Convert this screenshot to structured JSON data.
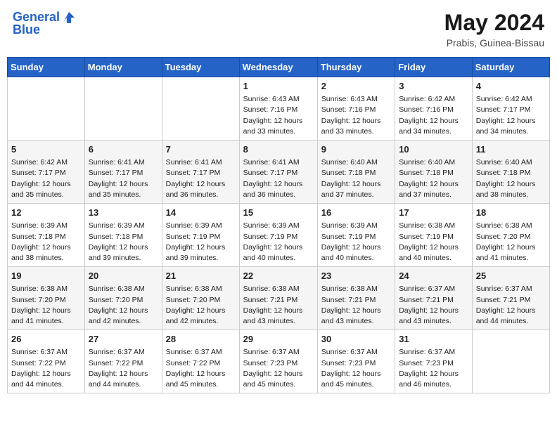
{
  "header": {
    "logo_line1": "General",
    "logo_line2": "Blue",
    "month_year": "May 2024",
    "location": "Prabis, Guinea-Bissau"
  },
  "weekdays": [
    "Sunday",
    "Monday",
    "Tuesday",
    "Wednesday",
    "Thursday",
    "Friday",
    "Saturday"
  ],
  "weeks": [
    [
      {
        "day": "",
        "sunrise": "",
        "sunset": "",
        "daylight": ""
      },
      {
        "day": "",
        "sunrise": "",
        "sunset": "",
        "daylight": ""
      },
      {
        "day": "",
        "sunrise": "",
        "sunset": "",
        "daylight": ""
      },
      {
        "day": "1",
        "sunrise": "Sunrise: 6:43 AM",
        "sunset": "Sunset: 7:16 PM",
        "daylight": "Daylight: 12 hours and 33 minutes."
      },
      {
        "day": "2",
        "sunrise": "Sunrise: 6:43 AM",
        "sunset": "Sunset: 7:16 PM",
        "daylight": "Daylight: 12 hours and 33 minutes."
      },
      {
        "day": "3",
        "sunrise": "Sunrise: 6:42 AM",
        "sunset": "Sunset: 7:16 PM",
        "daylight": "Daylight: 12 hours and 34 minutes."
      },
      {
        "day": "4",
        "sunrise": "Sunrise: 6:42 AM",
        "sunset": "Sunset: 7:17 PM",
        "daylight": "Daylight: 12 hours and 34 minutes."
      }
    ],
    [
      {
        "day": "5",
        "sunrise": "Sunrise: 6:42 AM",
        "sunset": "Sunset: 7:17 PM",
        "daylight": "Daylight: 12 hours and 35 minutes."
      },
      {
        "day": "6",
        "sunrise": "Sunrise: 6:41 AM",
        "sunset": "Sunset: 7:17 PM",
        "daylight": "Daylight: 12 hours and 35 minutes."
      },
      {
        "day": "7",
        "sunrise": "Sunrise: 6:41 AM",
        "sunset": "Sunset: 7:17 PM",
        "daylight": "Daylight: 12 hours and 36 minutes."
      },
      {
        "day": "8",
        "sunrise": "Sunrise: 6:41 AM",
        "sunset": "Sunset: 7:17 PM",
        "daylight": "Daylight: 12 hours and 36 minutes."
      },
      {
        "day": "9",
        "sunrise": "Sunrise: 6:40 AM",
        "sunset": "Sunset: 7:18 PM",
        "daylight": "Daylight: 12 hours and 37 minutes."
      },
      {
        "day": "10",
        "sunrise": "Sunrise: 6:40 AM",
        "sunset": "Sunset: 7:18 PM",
        "daylight": "Daylight: 12 hours and 37 minutes."
      },
      {
        "day": "11",
        "sunrise": "Sunrise: 6:40 AM",
        "sunset": "Sunset: 7:18 PM",
        "daylight": "Daylight: 12 hours and 38 minutes."
      }
    ],
    [
      {
        "day": "12",
        "sunrise": "Sunrise: 6:39 AM",
        "sunset": "Sunset: 7:18 PM",
        "daylight": "Daylight: 12 hours and 38 minutes."
      },
      {
        "day": "13",
        "sunrise": "Sunrise: 6:39 AM",
        "sunset": "Sunset: 7:18 PM",
        "daylight": "Daylight: 12 hours and 39 minutes."
      },
      {
        "day": "14",
        "sunrise": "Sunrise: 6:39 AM",
        "sunset": "Sunset: 7:19 PM",
        "daylight": "Daylight: 12 hours and 39 minutes."
      },
      {
        "day": "15",
        "sunrise": "Sunrise: 6:39 AM",
        "sunset": "Sunset: 7:19 PM",
        "daylight": "Daylight: 12 hours and 40 minutes."
      },
      {
        "day": "16",
        "sunrise": "Sunrise: 6:39 AM",
        "sunset": "Sunset: 7:19 PM",
        "daylight": "Daylight: 12 hours and 40 minutes."
      },
      {
        "day": "17",
        "sunrise": "Sunrise: 6:38 AM",
        "sunset": "Sunset: 7:19 PM",
        "daylight": "Daylight: 12 hours and 40 minutes."
      },
      {
        "day": "18",
        "sunrise": "Sunrise: 6:38 AM",
        "sunset": "Sunset: 7:20 PM",
        "daylight": "Daylight: 12 hours and 41 minutes."
      }
    ],
    [
      {
        "day": "19",
        "sunrise": "Sunrise: 6:38 AM",
        "sunset": "Sunset: 7:20 PM",
        "daylight": "Daylight: 12 hours and 41 minutes."
      },
      {
        "day": "20",
        "sunrise": "Sunrise: 6:38 AM",
        "sunset": "Sunset: 7:20 PM",
        "daylight": "Daylight: 12 hours and 42 minutes."
      },
      {
        "day": "21",
        "sunrise": "Sunrise: 6:38 AM",
        "sunset": "Sunset: 7:20 PM",
        "daylight": "Daylight: 12 hours and 42 minutes."
      },
      {
        "day": "22",
        "sunrise": "Sunrise: 6:38 AM",
        "sunset": "Sunset: 7:21 PM",
        "daylight": "Daylight: 12 hours and 43 minutes."
      },
      {
        "day": "23",
        "sunrise": "Sunrise: 6:38 AM",
        "sunset": "Sunset: 7:21 PM",
        "daylight": "Daylight: 12 hours and 43 minutes."
      },
      {
        "day": "24",
        "sunrise": "Sunrise: 6:37 AM",
        "sunset": "Sunset: 7:21 PM",
        "daylight": "Daylight: 12 hours and 43 minutes."
      },
      {
        "day": "25",
        "sunrise": "Sunrise: 6:37 AM",
        "sunset": "Sunset: 7:21 PM",
        "daylight": "Daylight: 12 hours and 44 minutes."
      }
    ],
    [
      {
        "day": "26",
        "sunrise": "Sunrise: 6:37 AM",
        "sunset": "Sunset: 7:22 PM",
        "daylight": "Daylight: 12 hours and 44 minutes."
      },
      {
        "day": "27",
        "sunrise": "Sunrise: 6:37 AM",
        "sunset": "Sunset: 7:22 PM",
        "daylight": "Daylight: 12 hours and 44 minutes."
      },
      {
        "day": "28",
        "sunrise": "Sunrise: 6:37 AM",
        "sunset": "Sunset: 7:22 PM",
        "daylight": "Daylight: 12 hours and 45 minutes."
      },
      {
        "day": "29",
        "sunrise": "Sunrise: 6:37 AM",
        "sunset": "Sunset: 7:23 PM",
        "daylight": "Daylight: 12 hours and 45 minutes."
      },
      {
        "day": "30",
        "sunrise": "Sunrise: 6:37 AM",
        "sunset": "Sunset: 7:23 PM",
        "daylight": "Daylight: 12 hours and 45 minutes."
      },
      {
        "day": "31",
        "sunrise": "Sunrise: 6:37 AM",
        "sunset": "Sunset: 7:23 PM",
        "daylight": "Daylight: 12 hours and 46 minutes."
      },
      {
        "day": "",
        "sunrise": "",
        "sunset": "",
        "daylight": ""
      }
    ]
  ]
}
